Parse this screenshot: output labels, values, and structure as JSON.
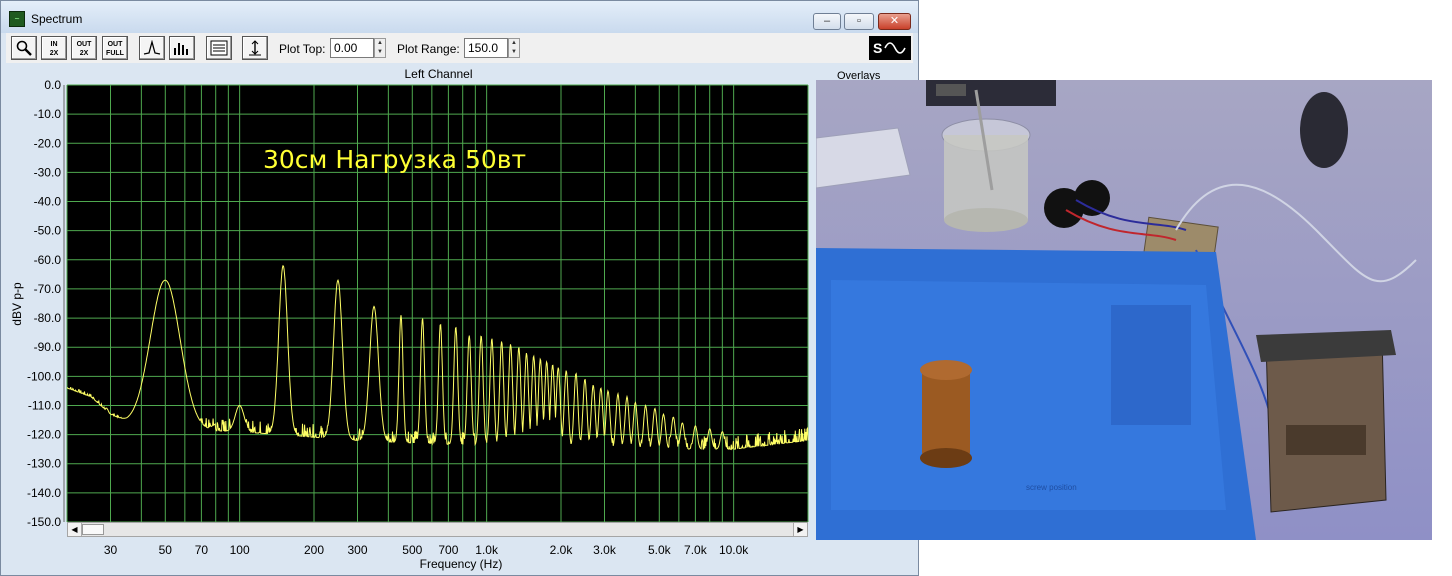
{
  "window": {
    "title": "Spectrum",
    "buttons": {
      "minimize": "–",
      "maximize": "▫",
      "close": "✕"
    }
  },
  "toolbar": {
    "zoom_icon": "magnifier-icon",
    "zoom_in_2x": [
      "IN",
      "2X"
    ],
    "zoom_out_2x": [
      "OUT",
      "2X"
    ],
    "zoom_out_full": [
      "OUT",
      "FULL"
    ],
    "plot_top_label": "Plot Top:",
    "plot_top_value": "0.00",
    "plot_range_label": "Plot Range:",
    "plot_range_value": "150.0"
  },
  "plot": {
    "channel_label": "Left Channel",
    "overlays_label": "Overlays",
    "overlay_text": "30см Нагрузка 50вт"
  },
  "chart_data": {
    "type": "line",
    "title": "Left Channel",
    "xlabel": "Frequency (Hz)",
    "ylabel": "dBV p-p",
    "x_scale": "log",
    "xlim": [
      20,
      20000
    ],
    "ylim": [
      -150,
      0
    ],
    "grid": true,
    "background": "#000000",
    "grid_color": "#4fa94f",
    "line_color": "#ffff66",
    "y_ticks": [
      "0.0",
      "-10.0",
      "-20.0",
      "-30.0",
      "-40.0",
      "-50.0",
      "-60.0",
      "-70.0",
      "-80.0",
      "-90.0",
      "-100.0",
      "-110.0",
      "-120.0",
      "-130.0",
      "-140.0",
      "-150.0"
    ],
    "x_tick_labels": [
      {
        "value": 30,
        "label": "30"
      },
      {
        "value": 50,
        "label": "50"
      },
      {
        "value": 70,
        "label": "70"
      },
      {
        "value": 100,
        "label": "100"
      },
      {
        "value": 200,
        "label": "200"
      },
      {
        "value": 300,
        "label": "300"
      },
      {
        "value": 500,
        "label": "500"
      },
      {
        "value": 700,
        "label": "700"
      },
      {
        "value": 1000,
        "label": "1.0k"
      },
      {
        "value": 2000,
        "label": "2.0k"
      },
      {
        "value": 3000,
        "label": "3.0k"
      },
      {
        "value": 5000,
        "label": "5.0k"
      },
      {
        "value": 7000,
        "label": "7.0k"
      },
      {
        "value": 10000,
        "label": "10.0k"
      }
    ],
    "series": [
      {
        "noise_floor": [
          [
            20,
            -104
          ],
          [
            25,
            -107
          ],
          [
            30,
            -113
          ],
          [
            35,
            -116
          ],
          [
            50,
            -118
          ],
          [
            100,
            -119
          ],
          [
            300,
            -122
          ],
          [
            1000,
            -124
          ],
          [
            3000,
            -125
          ],
          [
            10000,
            -125
          ],
          [
            20000,
            -122
          ]
        ],
        "peaks": [
          [
            50,
            -67
          ],
          [
            100,
            -110
          ],
          [
            150,
            -62
          ],
          [
            250,
            -67
          ],
          [
            350,
            -76
          ],
          [
            450,
            -79
          ],
          [
            550,
            -80
          ],
          [
            650,
            -82
          ],
          [
            750,
            -83
          ],
          [
            850,
            -86
          ],
          [
            950,
            -86
          ],
          [
            1050,
            -87
          ],
          [
            1150,
            -88
          ],
          [
            1250,
            -89
          ],
          [
            1350,
            -90
          ],
          [
            1450,
            -92
          ],
          [
            1550,
            -93
          ],
          [
            1650,
            -94
          ],
          [
            1750,
            -95
          ],
          [
            1850,
            -96
          ],
          [
            1950,
            -97
          ],
          [
            2100,
            -98
          ],
          [
            2300,
            -99
          ],
          [
            2500,
            -101
          ],
          [
            2700,
            -103
          ],
          [
            2900,
            -104
          ],
          [
            3100,
            -105
          ],
          [
            3400,
            -106
          ],
          [
            3700,
            -107
          ],
          [
            4000,
            -109
          ],
          [
            4400,
            -110
          ],
          [
            4800,
            -111
          ],
          [
            5200,
            -113
          ],
          [
            5700,
            -114
          ],
          [
            6200,
            -116
          ],
          [
            7000,
            -117
          ],
          [
            8000,
            -118
          ],
          [
            9000,
            -119
          ]
        ]
      }
    ]
  },
  "photo": {
    "description_hidden": true,
    "mat_text": [
      "screw position"
    ]
  }
}
